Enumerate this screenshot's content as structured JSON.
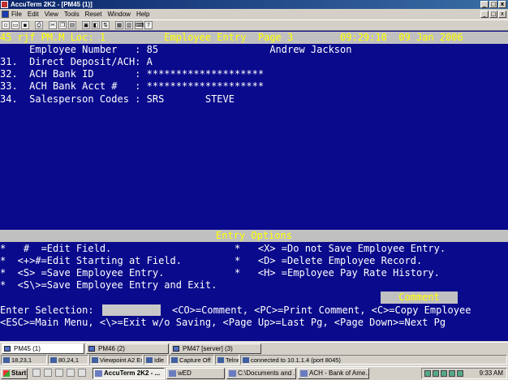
{
  "window": {
    "title": "AccuTerm 2K2 - [PM45 (1)]",
    "buttons": [
      "_",
      "□",
      "x"
    ]
  },
  "menu": {
    "items": [
      "File",
      "Edit",
      "View",
      "Tools",
      "Reset",
      "Window",
      "Help"
    ],
    "mdi_buttons": [
      "_",
      "□",
      "x"
    ]
  },
  "toolbar": {
    "icons": [
      "new-icon",
      "open-icon",
      "save-icon",
      "print-icon",
      "cut-icon",
      "copy-icon",
      "paste-icon",
      "screen-icon",
      "capture-icon",
      "transfer-icon",
      "settings-icon",
      "macro-icon",
      "keyboard-icon",
      "help-icon"
    ]
  },
  "terminal": {
    "status_line": "45 rjf PM.M Loc: 1          Employee Entry  Page 3        09:29:10  09 Jan 2006",
    "lines": [
      "     Employee Number   : 85                   Andrew Jackson",
      "31.  Direct Deposit/ACH: A",
      "32.  ACH Bank ID       : ********************",
      "33.  ACH Bank Acct #   : ********************",
      "34.  Salesperson Codes : SRS       STEVE"
    ],
    "entry_options_title": "Entry Options",
    "options_left": [
      "*   #  =Edit Field.",
      "*  <+>#=Edit Starting at Field.",
      "*  <S> =Save Employee Entry.",
      "*  <S\\>=Save Employee Entry and Exit."
    ],
    "options_right": [
      "*   <X> =Do not Save Employee Entry.",
      "*   <D> =Delete Employee Record.",
      "*   <H> =Employee Pay Rate History."
    ],
    "comment_label": "Comment",
    "selection_label": "Enter Selection:",
    "selection_value": "",
    "selection_commands": "<CO>=Comment, <PC>=Print Comment, <C>=Copy Employee",
    "nav_line": "<ESC>=Main Menu, <\\>=Exit w/o Saving, <Page Up>=Last Pg, <Page Down>=Next Pg"
  },
  "session_tabs": [
    {
      "label": "PM45 (1)",
      "active": true
    },
    {
      "label": "PM46 (2)",
      "active": false
    },
    {
      "label": "PM47 [server] (3)",
      "active": false
    }
  ],
  "statusbar": {
    "cursor": "18,23,1",
    "size": "80,24,1",
    "emulation": "Viewpoint A2 Enh",
    "state": "Idle",
    "capture": "Capture Off",
    "protocol": "Telnet",
    "connection": "connected to 10.1.1.4 (port 8045)"
  },
  "taskbar": {
    "start_label": "Start",
    "tasks": [
      {
        "label": "AccuTerm 2K2 - ...",
        "active": true
      },
      {
        "label": "wED",
        "active": false
      },
      {
        "label": "C:\\Documents and ...",
        "active": false
      },
      {
        "label": "ACH - Bank of Ame...",
        "active": false
      }
    ],
    "clock": "9:33 AM"
  },
  "colors": {
    "terminal_bg": "#0a0a8c",
    "terminal_fg": "#ffffff",
    "highlight_fg": "#ffff00",
    "highlight_bg": "#c0c0c0"
  }
}
